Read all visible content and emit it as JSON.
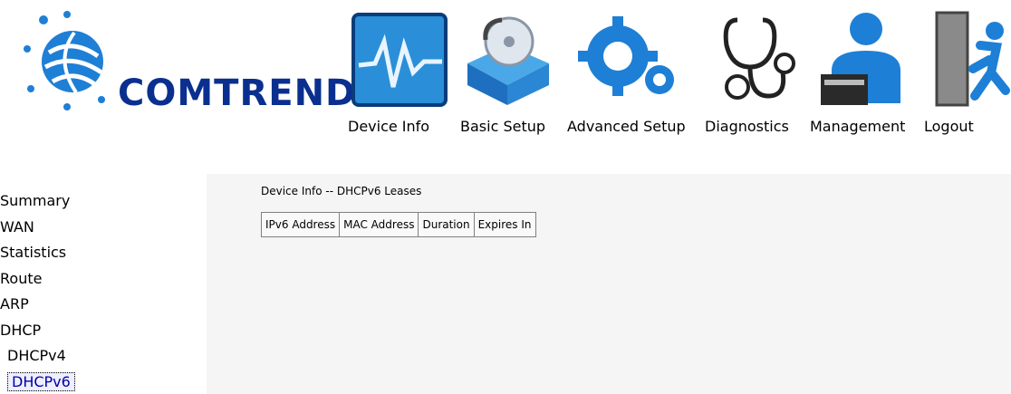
{
  "brand": {
    "name": "COMTREND"
  },
  "nav": {
    "device_info": "Device Info",
    "basic_setup": "Basic Setup",
    "advanced_setup": "Advanced Setup",
    "diagnostics": "Diagnostics",
    "management": "Management",
    "logout": "Logout"
  },
  "sidebar": {
    "items": [
      "Summary",
      "WAN",
      "Statistics",
      "Route",
      "ARP",
      "DHCP",
      "DHCPv4",
      "DHCPv6"
    ]
  },
  "main": {
    "title": "Device Info -- DHCPv6 Leases",
    "columns": [
      "IPv6 Address",
      "MAC Address",
      "Duration",
      "Expires In"
    ]
  },
  "colors": {
    "brand": "#0a2f8f",
    "accent": "#1e7fd6"
  }
}
